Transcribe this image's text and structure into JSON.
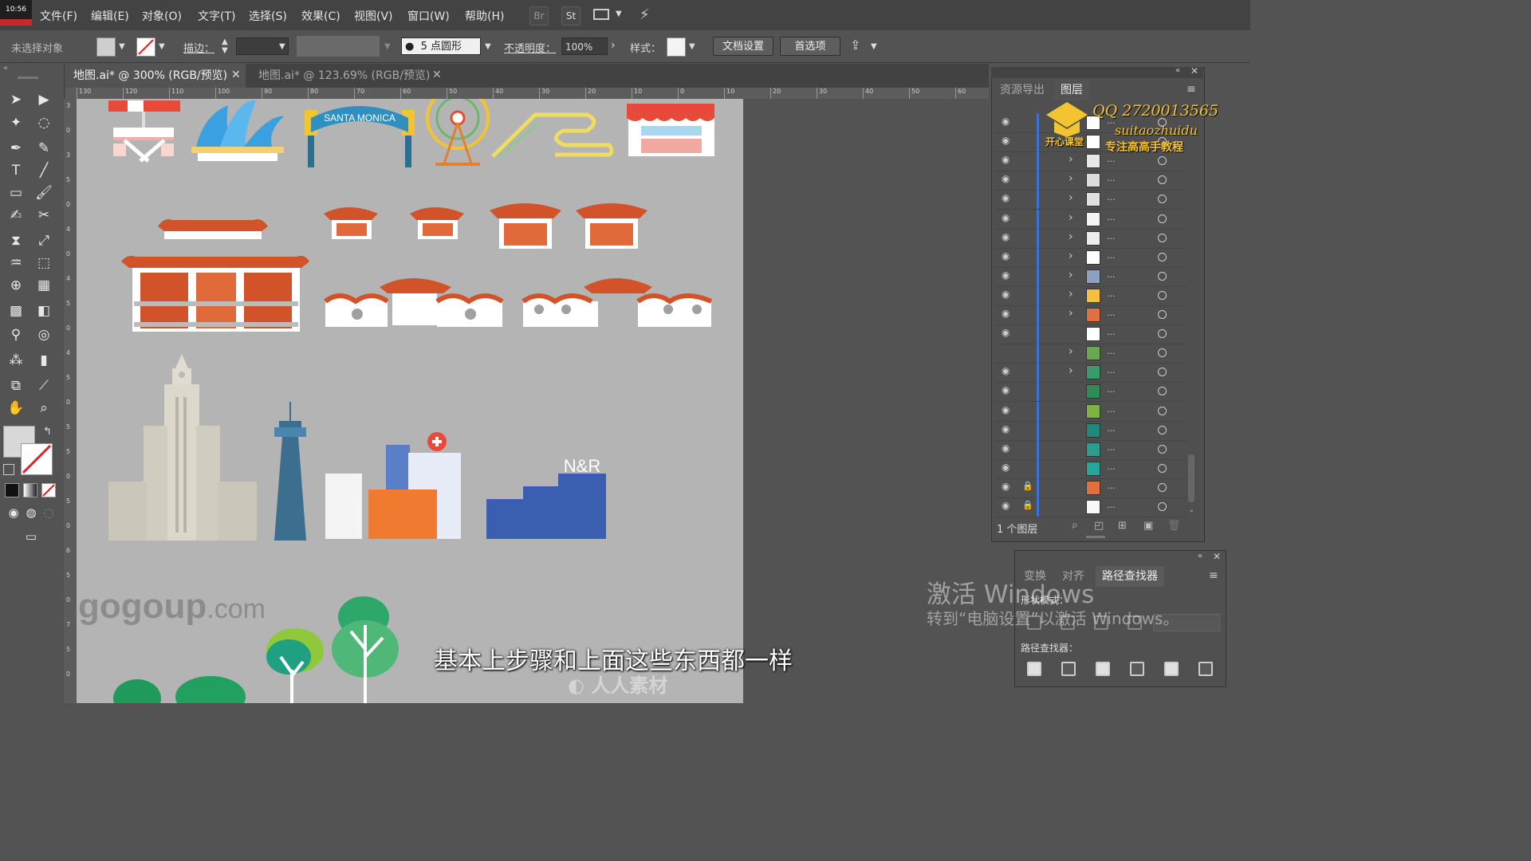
{
  "clock": "10:56",
  "menu": [
    "文件(F)",
    "编辑(E)",
    "对象(O)",
    "文字(T)",
    "选择(S)",
    "效果(C)",
    "视图(V)",
    "窗口(W)",
    "帮助(H)"
  ],
  "menu_buttons": {
    "br": "Br",
    "st": "St"
  },
  "control": {
    "selection": "未选择对象",
    "stroke_label": "描边：",
    "brush": "5 点圆形",
    "opacity_label": "不透明度：",
    "opacity_value": "100%",
    "style_label": "样式：",
    "doc_setup": "文档设置",
    "preferences": "首选项"
  },
  "tabs": [
    {
      "label": "地图.ai* @ 300% (RGB/预览)",
      "active": true
    },
    {
      "label": "地图.ai* @ 123.69% (RGB/预览)",
      "active": false
    }
  ],
  "ruler_top": [
    "130",
    "120",
    "110",
    "100",
    "90",
    "80",
    "70",
    "60",
    "50",
    "40",
    "30",
    "20",
    "10",
    "0",
    "10",
    "20",
    "30",
    "40",
    "50",
    "60"
  ],
  "ruler_left": [
    "3",
    "0",
    "3",
    "5",
    "0",
    "4",
    "0",
    "4",
    "5",
    "0",
    "4",
    "5",
    "0",
    "5",
    "5",
    "0",
    "5",
    "0",
    "6",
    "5",
    "0",
    "7",
    "5",
    "0"
  ],
  "artwork": {
    "arch_text": "SANTA MONICA",
    "nr_text": "N&R",
    "watermark_site": "gogoup",
    "watermark_site_suffix": ".com",
    "watermark_brand": "人人素材"
  },
  "layers_panel": {
    "tabs": [
      "资源导出",
      "图层"
    ],
    "active_tab": "图层",
    "row_dots": "...",
    "status": "1 个图层",
    "overlay_qq": "QQ 2720013565",
    "overlay_id": "suitaozhuidu",
    "overlay_logo": "开心课堂",
    "overlay_slogan": "专注高高手教程",
    "rows": [
      {
        "eye": true,
        "arrow": false,
        "lock": false,
        "thumb": "#ffffff"
      },
      {
        "eye": true,
        "arrow": false,
        "lock": false,
        "thumb": "#ffffff"
      },
      {
        "eye": true,
        "arrow": true,
        "lock": false,
        "thumb": "#e8e8e8"
      },
      {
        "eye": true,
        "arrow": true,
        "lock": false,
        "thumb": "#dcdcdc"
      },
      {
        "eye": true,
        "arrow": true,
        "lock": false,
        "thumb": "#e0e0e0"
      },
      {
        "eye": true,
        "arrow": true,
        "lock": false,
        "thumb": "#f4f4f4"
      },
      {
        "eye": true,
        "arrow": true,
        "lock": false,
        "thumb": "#ededed"
      },
      {
        "eye": true,
        "arrow": true,
        "lock": false,
        "thumb": "#ffffff"
      },
      {
        "eye": true,
        "arrow": true,
        "lock": false,
        "thumb": "#8ca0c0"
      },
      {
        "eye": true,
        "arrow": true,
        "lock": false,
        "thumb": "#f4c040"
      },
      {
        "eye": true,
        "arrow": true,
        "lock": false,
        "thumb": "#e07040"
      },
      {
        "eye": true,
        "arrow": false,
        "lock": false,
        "thumb": "#ffffff"
      },
      {
        "eye": false,
        "arrow": true,
        "lock": false,
        "thumb": "#6aa84f"
      },
      {
        "eye": true,
        "arrow": true,
        "lock": false,
        "thumb": "#3a9a6a"
      },
      {
        "eye": true,
        "arrow": false,
        "lock": false,
        "thumb": "#2e8b57"
      },
      {
        "eye": true,
        "arrow": false,
        "lock": false,
        "thumb": "#7cb342"
      },
      {
        "eye": true,
        "arrow": false,
        "lock": false,
        "thumb": "#1f8a7a"
      },
      {
        "eye": true,
        "arrow": false,
        "lock": false,
        "thumb": "#2a9d8f"
      },
      {
        "eye": true,
        "arrow": false,
        "lock": false,
        "thumb": "#26a69a"
      },
      {
        "eye": true,
        "arrow": false,
        "lock": true,
        "thumb": "#e07040"
      },
      {
        "eye": true,
        "arrow": false,
        "lock": true,
        "thumb": "#f8f8f8"
      }
    ]
  },
  "pathfinder_panel": {
    "tabs": [
      "变换",
      "对齐",
      "路径查找器"
    ],
    "active_tab": "路径查找器",
    "shape_modes": "形状模式：",
    "pathfinders": "路径查找器："
  },
  "windows_watermark": {
    "line1": "激活 Windows",
    "line2": "转到“电脑设置”以激活 Windows。"
  },
  "subtitle": "基本上步骤和上面这些东西都一样",
  "colors": {
    "roof": "#d2532a",
    "tower_blue": "#3b6e8f",
    "stripe_blue": "#3a5fb0",
    "tree_green": "#3aa05a",
    "overlay_yellow": "#f4c430"
  }
}
